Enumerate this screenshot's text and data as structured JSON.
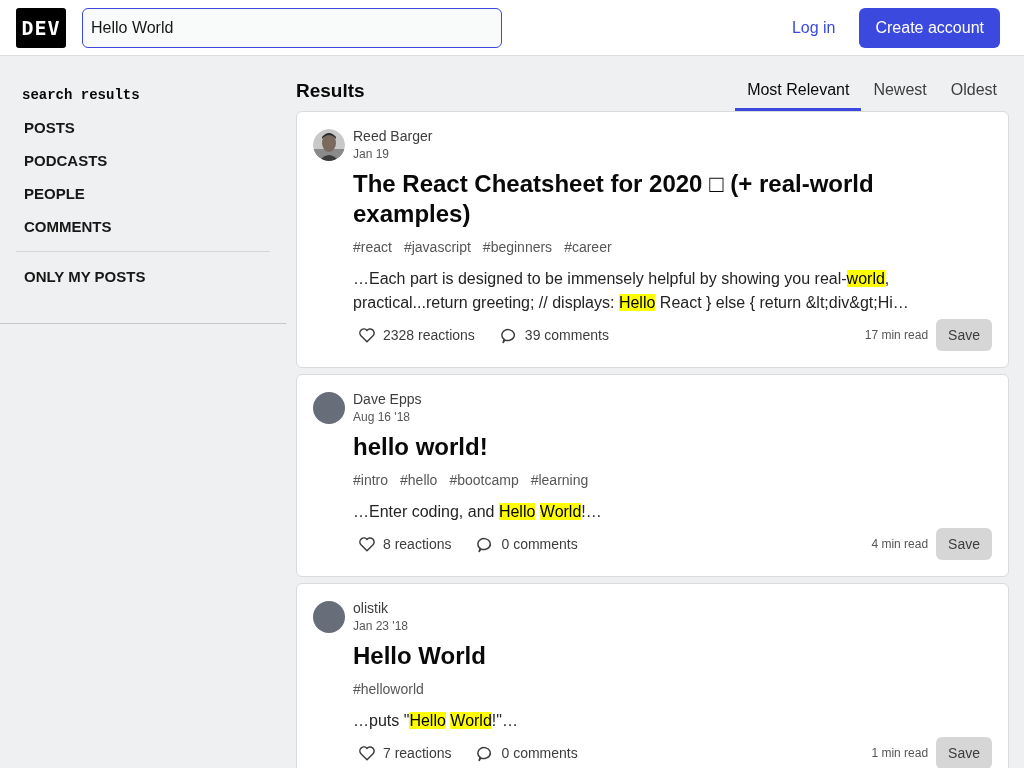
{
  "header": {
    "logo": "DEV",
    "search": {
      "value": "Hello World"
    },
    "login": "Log in",
    "create_account": "Create account"
  },
  "sidebar": {
    "heading": "search results",
    "items": [
      {
        "label": "POSTS"
      },
      {
        "label": "PODCASTS"
      },
      {
        "label": "PEOPLE"
      },
      {
        "label": "COMMENTS"
      }
    ],
    "filter": "ONLY MY POSTS"
  },
  "results": {
    "title": "Results",
    "tabs": [
      {
        "label": "Most Relevant",
        "selected": true
      },
      {
        "label": "Newest",
        "selected": false
      },
      {
        "label": "Oldest",
        "selected": false
      }
    ],
    "posts": [
      {
        "author": "Reed Barger",
        "avatar": {
          "kind": "picture"
        },
        "date": "Jan 19",
        "title": "The React Cheatsheet for 2020 □ (+ real-world examples)",
        "tags": [
          "#react",
          "#javascript",
          "#beginners",
          "#career"
        ],
        "excerpt": [
          {
            "text": "…Each part is designed to be immensely helpful by showing you real-",
            "highlight": false
          },
          {
            "text": "world",
            "highlight": true
          },
          {
            "text": ", practical...return greeting; // displays: ",
            "highlight": false
          },
          {
            "text": "Hello",
            "highlight": true
          },
          {
            "text": " React } else { return &lt;div&gt;Hi…",
            "highlight": false
          }
        ],
        "reactions": "2328 reactions",
        "comments": "39 comments",
        "read_time": "17 min read",
        "save": "Save"
      },
      {
        "author": "Dave Epps",
        "avatar": {
          "kind": "blank"
        },
        "date": "Aug 16 '18",
        "title": "hello world!",
        "tags": [
          "#intro",
          "#hello",
          "#bootcamp",
          "#learning"
        ],
        "excerpt": [
          {
            "text": "…Enter coding, and ",
            "highlight": false
          },
          {
            "text": "Hello",
            "highlight": true,
            "space_after": true
          },
          {
            "text": "World",
            "highlight": true
          },
          {
            "text": "!…",
            "highlight": false
          }
        ],
        "reactions": "8 reactions",
        "comments": "0 comments",
        "read_time": "4 min read",
        "save": "Save"
      },
      {
        "author": "olistik",
        "avatar": {
          "kind": "blank"
        },
        "date": "Jan 23 '18",
        "title": "Hello World",
        "tags": [
          "#helloworld"
        ],
        "excerpt": [
          {
            "text": "…puts \"",
            "highlight": false
          },
          {
            "text": "Hello",
            "highlight": true,
            "space_after": true
          },
          {
            "text": "World",
            "highlight": true
          },
          {
            "text": "!\"…",
            "highlight": false
          }
        ],
        "reactions": "7 reactions",
        "comments": "0 comments",
        "read_time": "1 min read",
        "save": "Save"
      }
    ]
  }
}
